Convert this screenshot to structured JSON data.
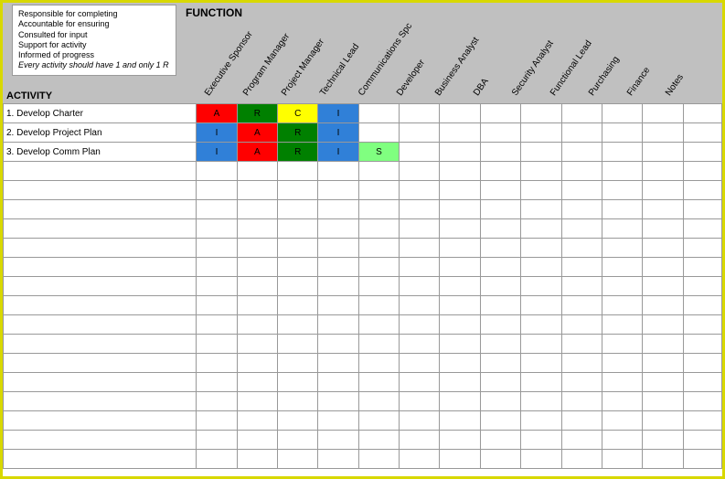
{
  "legend": {
    "r": "Responsible for completing",
    "a": "Accountable for ensuring",
    "c": "Consulted for input",
    "s": "Support for activity",
    "i": "Informed of progress",
    "rule": "Every activity should have 1 and only 1 R"
  },
  "function_label": "FUNCTION",
  "activity_label": "ACTIVITY",
  "columns": [
    "Executive Sponsor",
    "Program Manager",
    "Project Manager",
    "Technical Lead",
    "Communications Spc",
    "Developer",
    "Business Analyst",
    "DBA",
    "Security Analyst",
    "Functional Lead",
    "Purchasing",
    "Finance",
    "Notes"
  ],
  "colors": {
    "A": "c-red",
    "R": "c-green",
    "C": "c-yellow",
    "I": "c-blue",
    "S": "c-lgreen"
  },
  "rows": [
    {
      "activity": "1. Develop Charter",
      "cells": [
        "A",
        "R",
        "C",
        "I",
        "",
        "",
        "",
        "",
        "",
        "",
        "",
        "",
        ""
      ]
    },
    {
      "activity": "2. Develop Project Plan",
      "cells": [
        "I",
        "A",
        "R",
        "I",
        "",
        "",
        "",
        "",
        "",
        "",
        "",
        "",
        ""
      ]
    },
    {
      "activity": "3. Develop Comm Plan",
      "cells": [
        "I",
        "A",
        "R",
        "I",
        "S",
        "",
        "",
        "",
        "",
        "",
        "",
        "",
        ""
      ]
    }
  ],
  "empty_rows": 16
}
